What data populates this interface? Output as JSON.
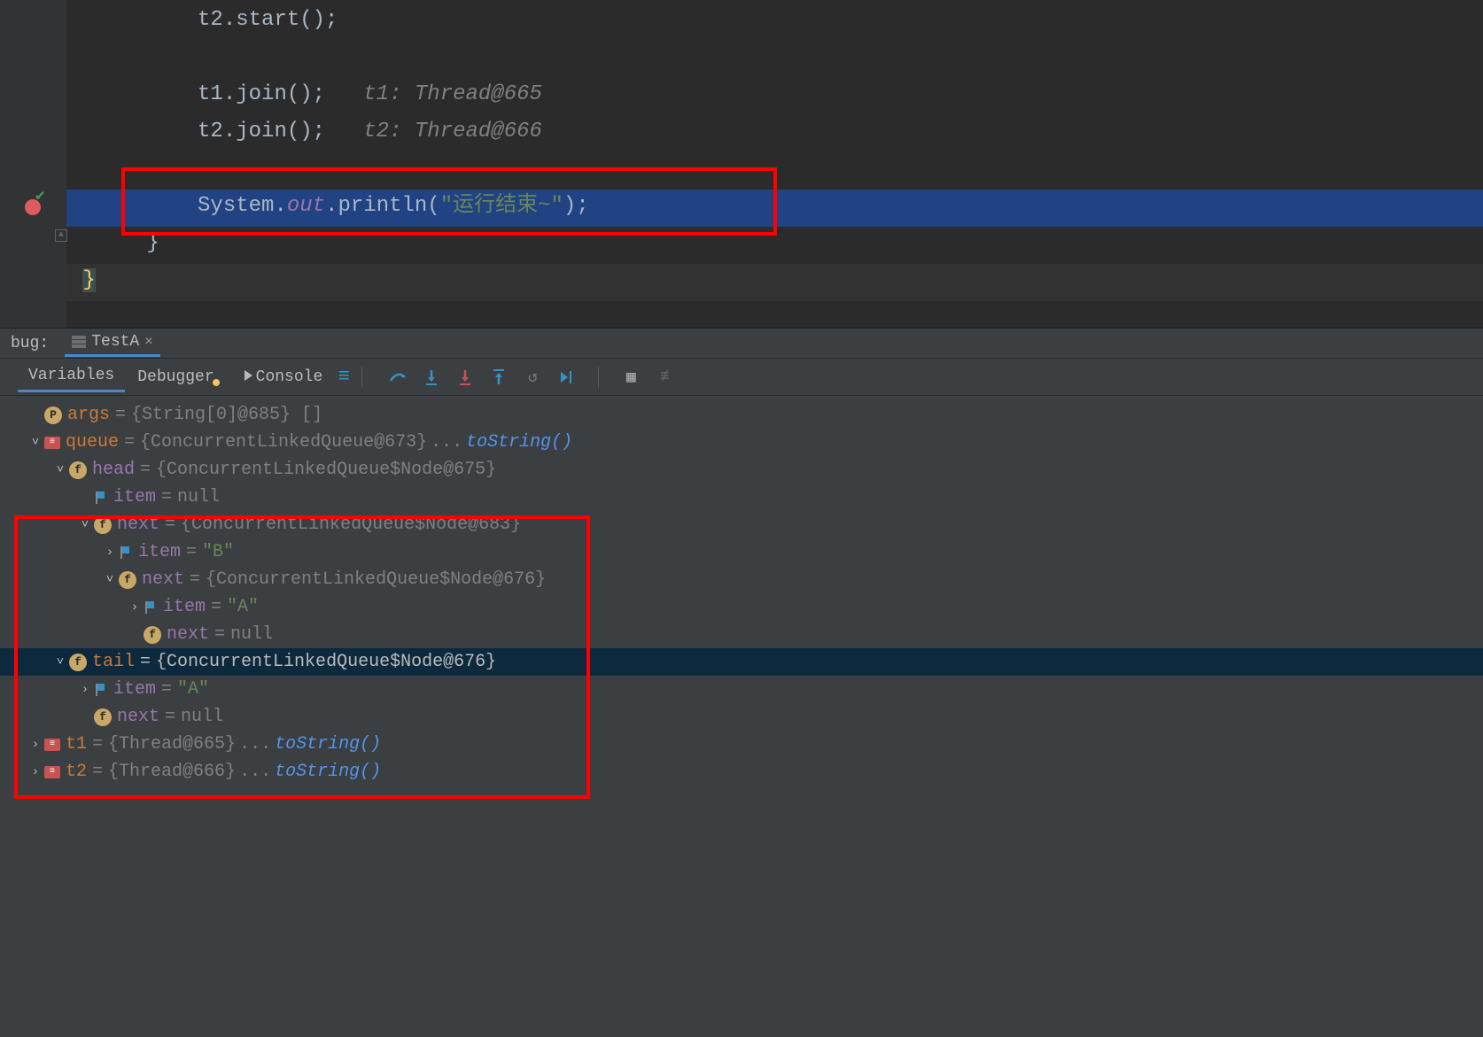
{
  "debug_label": "bug:",
  "tab": {
    "title": "TestA"
  },
  "code": {
    "l1": "t2.start();",
    "l3a": "t1.join();",
    "l3c": "t1: Thread@665",
    "l4a": "t2.join();",
    "l4c": "t2: Thread@666",
    "l6_sys": "System.",
    "l6_out": "out",
    "l6_print": ".println(",
    "l6_str": "\"运行结束~\"",
    "l6_end": ");",
    "l7": "}",
    "l8": "}"
  },
  "toolbar": {
    "tabs": {
      "variables": "Variables",
      "debugger": "Debugger",
      "console": "Console"
    }
  },
  "vars": {
    "args": {
      "name": "args",
      "val": "{String[0]@685} []"
    },
    "queue": {
      "name": "queue",
      "val": "{ConcurrentLinkedQueue@673}",
      "link": "toString()"
    },
    "head": {
      "name": "head",
      "val": "{ConcurrentLinkedQueue$Node@675}"
    },
    "head_item": {
      "name": "item",
      "val": "null"
    },
    "head_next": {
      "name": "next",
      "val": "{ConcurrentLinkedQueue$Node@683}"
    },
    "h_next_item": {
      "name": "item",
      "val": "\"B\""
    },
    "h_next_next": {
      "name": "next",
      "val": "{ConcurrentLinkedQueue$Node@676}"
    },
    "hnn_item": {
      "name": "item",
      "val": "\"A\""
    },
    "hnn_next": {
      "name": "next",
      "val": "null"
    },
    "tail": {
      "name": "tail",
      "val": "{ConcurrentLinkedQueue$Node@676}"
    },
    "tail_item": {
      "name": "item",
      "val": "\"A\""
    },
    "tail_next": {
      "name": "next",
      "val": "null"
    },
    "t1": {
      "name": "t1",
      "val": "{Thread@665}",
      "link": "toString()"
    },
    "t2": {
      "name": "t2",
      "val": "{Thread@666}",
      "link": "toString()"
    },
    "ellipsis": "..."
  }
}
